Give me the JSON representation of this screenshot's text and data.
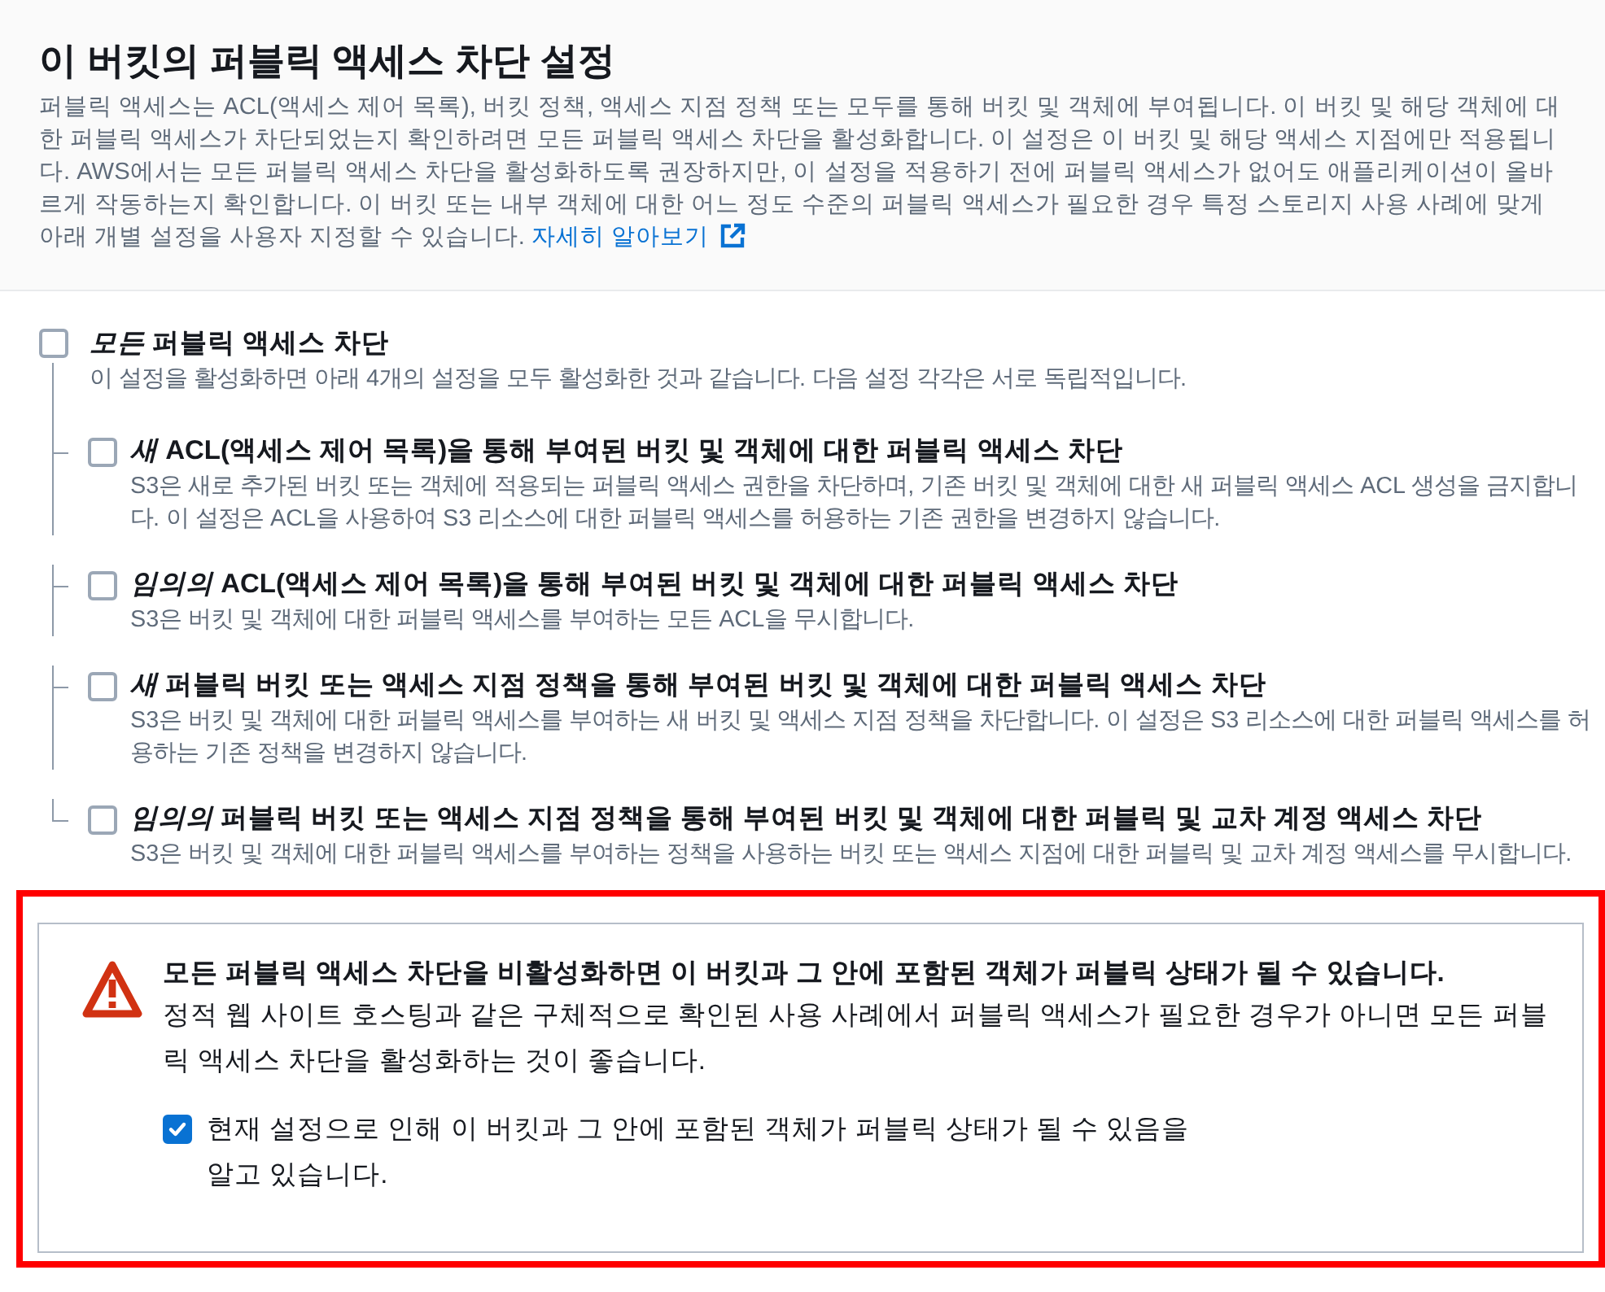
{
  "header": {
    "title": "이 버킷의 퍼블릭 액세스 차단 설정",
    "description": "퍼블릭 액세스는 ACL(액세스 제어 목록), 버킷 정책, 액세스 지점 정책 또는 모두를 통해 버킷 및 객체에 부여됩니다. 이 버킷 및 해당 객체에 대한 퍼블릭 액세스가 차단되었는지 확인하려면 모든 퍼블릭 액세스 차단을 활성화합니다. 이 설정은 이 버킷 및 해당 액세스 지점에만 적용됩니다. AWS에서는 모든 퍼블릭 액세스 차단을 활성화하도록 권장하지만, 이 설정을 적용하기 전에 퍼블릭 액세스가 없어도 애플리케이션이 올바르게 작동하는지 확인합니다. 이 버킷 또는 내부 객체에 대한 어느 정도 수준의 퍼블릭 액세스가 필요한 경우 특정 스토리지 사용 사례에 맞게 아래 개별 설정을 사용자 지정할 수 있습니다.",
    "link": "자세히 알아보기"
  },
  "block_all": {
    "label": "*모든* 퍼블릭 액세스 차단",
    "checked": false,
    "description": "이 설정을 활성화하면 아래 4개의 설정을 모두 활성화한 것과 같습니다. 다음 설정 각각은 서로 독립적입니다.",
    "children": [
      {
        "label": "*새* ACL(액세스 제어 목록)을 통해 부여된 버킷 및 객체에 대한 퍼블릭 액세스 차단",
        "checked": false,
        "description": "S3은 새로 추가된 버킷 또는 객체에 적용되는 퍼블릭 액세스 권한을 차단하며, 기존 버킷 및 객체에 대한 새 퍼블릭 액세스 ACL 생성을 금지합니다. 이 설정은 ACL을 사용하여 S3 리소스에 대한 퍼블릭 액세스를 허용하는 기존 권한을 변경하지 않습니다."
      },
      {
        "label": "*임의의* ACL(액세스 제어 목록)을 통해 부여된 버킷 및 객체에 대한 퍼블릭 액세스 차단",
        "checked": false,
        "description": "S3은 버킷 및 객체에 대한 퍼블릭 액세스를 부여하는 모든 ACL을 무시합니다."
      },
      {
        "label": "*새* 퍼블릭 버킷 또는 액세스 지점 정책을 통해 부여된 버킷 및 객체에 대한 퍼블릭 액세스 차단",
        "checked": false,
        "description": "S3은 버킷 및 객체에 대한 퍼블릭 액세스를 부여하는 새 버킷 및 액세스 지점 정책을 차단합니다. 이 설정은 S3 리소스에 대한 퍼블릭 액세스를 허용하는 기존 정책을 변경하지 않습니다."
      },
      {
        "label": "*임의의* 퍼블릭 버킷 또는 액세스 지점 정책을 통해 부여된 버킷 및 객체에 대한 퍼블릭 및 교차 계정 액세스 차단",
        "checked": false,
        "description": "S3은 버킷 및 객체에 대한 퍼블릭 액세스를 부여하는 정책을 사용하는 버킷 또는 액세스 지점에 대한 퍼블릭 및 교차 계정 액세스를 무시합니다."
      }
    ]
  },
  "warning": {
    "title": "모든 퍼블릭 액세스 차단을 비활성화하면 이 버킷과 그 안에 포함된 객체가 퍼블릭 상태가 될 수 있습니다.",
    "message": "정적 웹 사이트 호스팅과 같은 구체적으로 확인된 사용 사례에서 퍼블릭 액세스가 필요한 경우가 아니면 모든 퍼블릭 액세스 차단을 활성화하는 것이 좋습니다.",
    "acknowledge": {
      "label": "현재 설정으로 인해 이 버킷과 그 안에 포함된 객체가 퍼블릭 상태가 될 수 있음을 알고 있습니다.",
      "checked": true
    }
  }
}
